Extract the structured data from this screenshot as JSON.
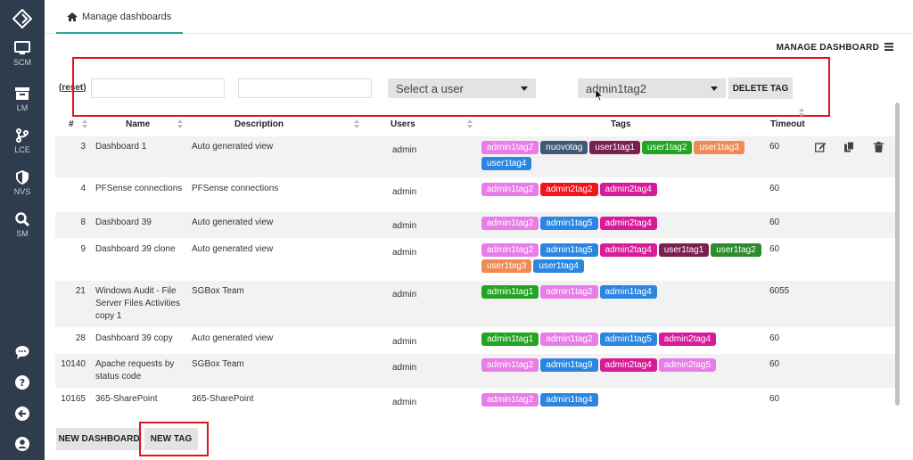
{
  "sidebar": {
    "items": [
      {
        "label": "SCM",
        "icon": "monitor-icon"
      },
      {
        "label": "LM",
        "icon": "archive-icon"
      },
      {
        "label": "LCE",
        "icon": "branch-icon"
      },
      {
        "label": "NVS",
        "icon": "shield-icon"
      },
      {
        "label": "SM",
        "icon": "search-icon"
      }
    ],
    "bottom_icons": [
      "chat-icon",
      "help-icon",
      "back-icon",
      "user-icon"
    ]
  },
  "tab": {
    "label": "Manage dashboards",
    "icon": "home-icon"
  },
  "manage_dashboard_label": "MANAGE DASHBOARD",
  "filters": {
    "reset_label": "reset",
    "name_value": "",
    "description_value": "",
    "user_select": "Select a user",
    "tag_select": "admin1tag2",
    "delete_tag_label": "DELETE TAG"
  },
  "table": {
    "headers": {
      "id": "#",
      "name": "Name",
      "description": "Description",
      "users": "Users",
      "tags": "Tags",
      "timeout": "Timeout"
    },
    "rows": [
      {
        "id": "3",
        "name": "Dashboard 1",
        "description": "Auto generated view",
        "user": "admin",
        "timeout": "60",
        "tags": [
          {
            "t": "admin1tag2",
            "c": "#e87ce8"
          },
          {
            "t": "nuovotag",
            "c": "#3f5a73"
          },
          {
            "t": "user1tag1",
            "c": "#7a2150"
          },
          {
            "t": "user1tag2",
            "c": "#23a423"
          },
          {
            "t": "user1tag3",
            "c": "#ee8a55"
          },
          {
            "t": "user1tag4",
            "c": "#2a86e0"
          }
        ]
      },
      {
        "id": "4",
        "name": "PFSense connections",
        "description": "PFSense connections",
        "user": "admin",
        "timeout": "60",
        "tags": [
          {
            "t": "admin1tag2",
            "c": "#e87ce8"
          },
          {
            "t": "admin2tag2",
            "c": "#f0141c"
          },
          {
            "t": "admin2tag4",
            "c": "#d81b99"
          }
        ]
      },
      {
        "id": "8",
        "name": "Dashboard 39",
        "description": "Auto generated view",
        "user": "admin",
        "timeout": "60",
        "tags": [
          {
            "t": "admin1tag2",
            "c": "#e87ce8"
          },
          {
            "t": "admin1tag5",
            "c": "#2a86e0"
          },
          {
            "t": "admin2tag4",
            "c": "#d81b99"
          }
        ]
      },
      {
        "id": "9",
        "name": "Dashboard 39 clone",
        "description": "Auto generated view",
        "user": "admin",
        "timeout": "60",
        "tags": [
          {
            "t": "admin1tag2",
            "c": "#e87ce8"
          },
          {
            "t": "admin1tag5",
            "c": "#2a86e0"
          },
          {
            "t": "admin2tag4",
            "c": "#d81b99"
          },
          {
            "t": "user1tag1",
            "c": "#7a2150"
          },
          {
            "t": "user1tag2",
            "c": "#2d8a2d"
          },
          {
            "t": "user1tag3",
            "c": "#ee8a55"
          },
          {
            "t": "user1tag4",
            "c": "#2a86e0"
          }
        ]
      },
      {
        "id": "21",
        "name": "Windows Audit - File Server Files Activities copy 1",
        "description": "SGBox Team",
        "user": "admin",
        "timeout": "6055",
        "tags": [
          {
            "t": "admin1tag1",
            "c": "#23a423"
          },
          {
            "t": "admin1tag2",
            "c": "#e87ce8"
          },
          {
            "t": "admin1tag4",
            "c": "#2a86e0"
          }
        ]
      },
      {
        "id": "28",
        "name": "Dashboard 39 copy",
        "description": "Auto generated view",
        "user": "admin",
        "timeout": "60",
        "tags": [
          {
            "t": "admin1tag1",
            "c": "#23a423"
          },
          {
            "t": "admin1tag2",
            "c": "#e87ce8"
          },
          {
            "t": "admin1tag5",
            "c": "#2a86e0"
          },
          {
            "t": "admin2tag4",
            "c": "#d81b99"
          }
        ]
      },
      {
        "id": "10140",
        "name": "Apache requests by status code",
        "description": "SGBox Team",
        "user": "admin",
        "timeout": "60",
        "tags": [
          {
            "t": "admin1tag2",
            "c": "#e87ce8"
          },
          {
            "t": "admin1tag9",
            "c": "#2a86e0"
          },
          {
            "t": "admin2tag4",
            "c": "#d81b99"
          },
          {
            "t": "admin2tag5",
            "c": "#e87ce8"
          }
        ]
      },
      {
        "id": "10165",
        "name": "365-SharePoint",
        "description": "365-SharePoint",
        "user": "admin",
        "timeout": "60",
        "tags": [
          {
            "t": "admin1tag2",
            "c": "#e87ce8"
          },
          {
            "t": "admin1tag4",
            "c": "#2a86e0"
          }
        ]
      }
    ]
  },
  "row_actions": [
    "edit-icon",
    "copy-icon",
    "trash-icon"
  ],
  "buttons": {
    "new_dashboard": "NEW DASHBOARD",
    "new_tag": "NEW TAG"
  },
  "colors": {
    "sidebar": "#2f3c4d",
    "accent": "#26a69a",
    "highlight": "#e0161c"
  }
}
